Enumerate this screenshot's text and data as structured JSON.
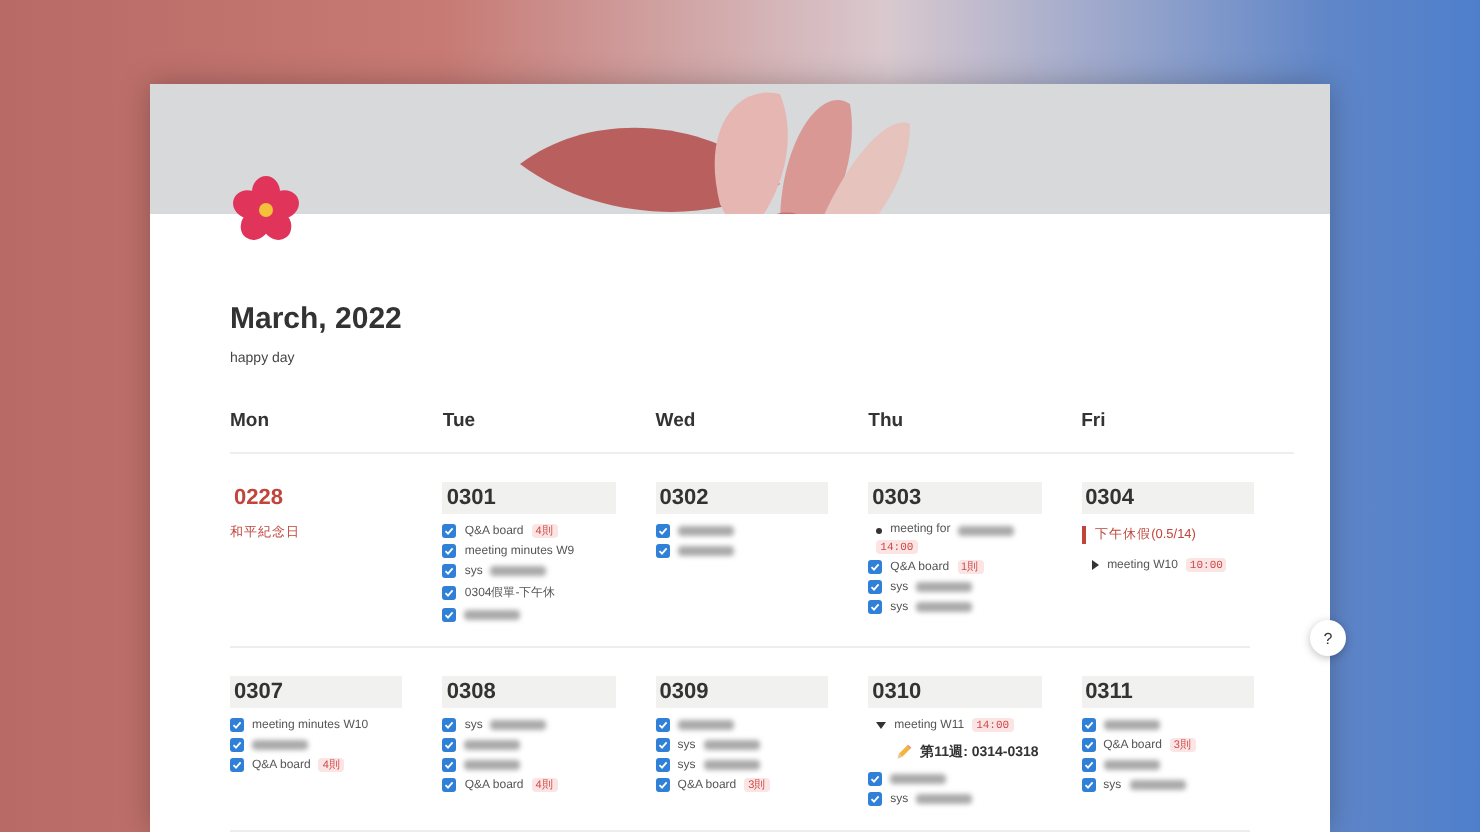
{
  "page": {
    "title": "March, 2022",
    "description": "happy day"
  },
  "weekdays": [
    "Mon",
    "Tue",
    "Wed",
    "Thu",
    "Fri"
  ],
  "weeks": [
    {
      "days": [
        {
          "date": "0228",
          "kind": "holiday",
          "note": "和平紀念日"
        },
        {
          "date": "0301",
          "kind": "day",
          "items": [
            {
              "kind": "todo",
              "checked": true,
              "text": "Q&A board",
              "tag": "4則"
            },
            {
              "kind": "todo",
              "checked": true,
              "text": "meeting minutes W9"
            },
            {
              "kind": "todo",
              "checked": true,
              "text": "sys",
              "redacted": true
            },
            {
              "kind": "todo",
              "checked": true,
              "text": "0304假單-下午休"
            },
            {
              "kind": "todo",
              "checked": true,
              "redacted": true
            }
          ]
        },
        {
          "date": "0302",
          "kind": "day",
          "items": [
            {
              "kind": "todo",
              "checked": true,
              "redacted": true
            },
            {
              "kind": "todo",
              "checked": true,
              "redacted": true
            }
          ]
        },
        {
          "date": "0303",
          "kind": "day",
          "items": [
            {
              "kind": "bullet",
              "text": "meeting for",
              "redacted": true,
              "time": "14:00"
            },
            {
              "kind": "todo",
              "checked": true,
              "text": "Q&A board",
              "tag": "1則"
            },
            {
              "kind": "todo",
              "checked": true,
              "text": "sys",
              "redacted": true
            },
            {
              "kind": "todo",
              "checked": true,
              "text": "sys",
              "redacted": true
            }
          ]
        },
        {
          "date": "0304",
          "kind": "day",
          "items": [
            {
              "kind": "quote",
              "text": "下午休假(0.5/14)"
            },
            {
              "kind": "toggle",
              "expanded": false,
              "text": "meeting W10",
              "time": "10:00"
            }
          ]
        }
      ]
    },
    {
      "days": [
        {
          "date": "0307",
          "kind": "day",
          "items": [
            {
              "kind": "todo",
              "checked": true,
              "text": "meeting minutes W10"
            },
            {
              "kind": "todo",
              "checked": true,
              "redacted": true
            },
            {
              "kind": "todo",
              "checked": true,
              "text": "Q&A board",
              "tag": "4則"
            }
          ]
        },
        {
          "date": "0308",
          "kind": "day",
          "items": [
            {
              "kind": "todo",
              "checked": true,
              "text": "sys",
              "redacted": true
            },
            {
              "kind": "todo",
              "checked": true,
              "redacted": true
            },
            {
              "kind": "todo",
              "checked": true,
              "redacted": true
            },
            {
              "kind": "todo",
              "checked": true,
              "text": "Q&A board",
              "tag": "4則"
            }
          ]
        },
        {
          "date": "0309",
          "kind": "day",
          "items": [
            {
              "kind": "todo",
              "checked": true,
              "redacted": true
            },
            {
              "kind": "todo",
              "checked": true,
              "text": "sys",
              "redacted": true
            },
            {
              "kind": "todo",
              "checked": true,
              "text": "sys",
              "redacted": true
            },
            {
              "kind": "todo",
              "checked": true,
              "text": "Q&A board",
              "tag": "3則"
            }
          ]
        },
        {
          "date": "0310",
          "kind": "day",
          "items": [
            {
              "kind": "toggle",
              "expanded": true,
              "text": "meeting W11",
              "time": "14:00",
              "children": [
                {
                  "kind": "note",
                  "text": "第11週: 0314-0318"
                }
              ]
            },
            {
              "kind": "todo",
              "checked": true,
              "redacted": true
            },
            {
              "kind": "todo",
              "checked": true,
              "text": "sys",
              "redacted": true
            }
          ]
        },
        {
          "date": "0311",
          "kind": "day",
          "items": [
            {
              "kind": "todo",
              "checked": true,
              "redacted": true
            },
            {
              "kind": "todo",
              "checked": true,
              "text": "Q&A board",
              "tag": "3則"
            },
            {
              "kind": "todo",
              "checked": true,
              "redacted": true
            },
            {
              "kind": "todo",
              "checked": true,
              "text": "sys",
              "redacted": true
            }
          ]
        }
      ]
    }
  ],
  "help_button": "?"
}
